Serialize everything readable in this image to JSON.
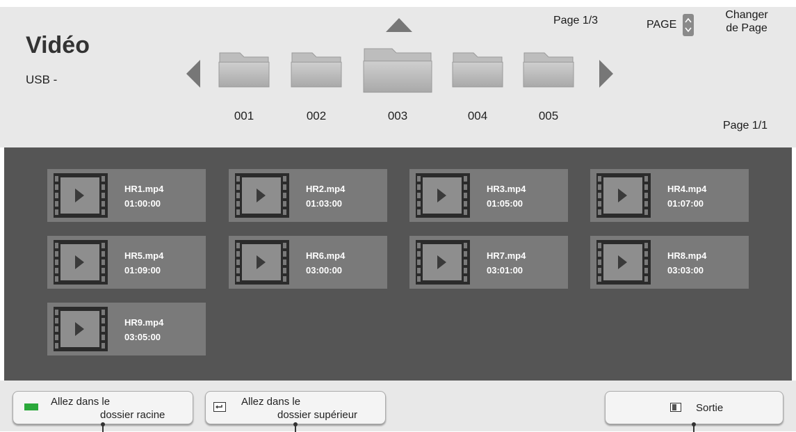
{
  "header": {
    "title": "Vidéo",
    "source": "USB -",
    "page_indicator_top": "Page 1/3",
    "page_key_label": "PAGE",
    "change_page_line1": "Changer",
    "change_page_line2": "de Page",
    "page_indicator_bottom": "Page 1/1"
  },
  "folders": [
    {
      "label": "001",
      "selected": false
    },
    {
      "label": "002",
      "selected": false
    },
    {
      "label": "003",
      "selected": true
    },
    {
      "label": "004",
      "selected": false
    },
    {
      "label": "005",
      "selected": false
    }
  ],
  "videos": [
    {
      "name": "HR1.mp4",
      "duration": "01:00:00"
    },
    {
      "name": "HR2.mp4",
      "duration": "01:03:00"
    },
    {
      "name": "HR3.mp4",
      "duration": "01:05:00"
    },
    {
      "name": "HR4.mp4",
      "duration": "01:07:00"
    },
    {
      "name": "HR5.mp4",
      "duration": "01:09:00"
    },
    {
      "name": "HR6.mp4",
      "duration": "03:00:00"
    },
    {
      "name": "HR7.mp4",
      "duration": "03:01:00"
    },
    {
      "name": "HR8.mp4",
      "duration": "03:03:00"
    },
    {
      "name": "HR9.mp4",
      "duration": "03:05:00"
    }
  ],
  "footer": {
    "root_line1": "Allez dans le",
    "root_line2": "dossier racine",
    "up_line1": "Allez dans le",
    "up_line2": "dossier supérieur",
    "exit_label": "Sortie"
  },
  "colors": {
    "green_key": "#2aa83a",
    "panel_bg": "#e8e8e8",
    "grid_bg": "#555555",
    "tile_bg": "#7a7a7a"
  }
}
